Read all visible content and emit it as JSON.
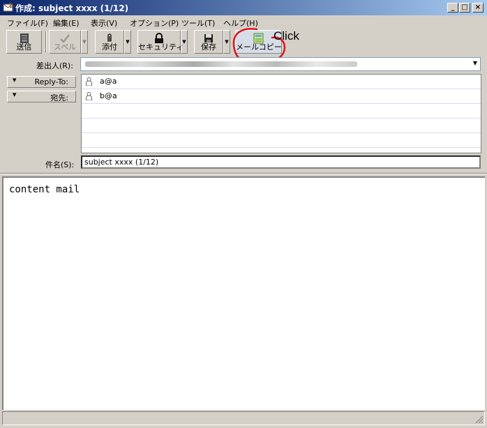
{
  "window": {
    "title": "作成: subject xxxx (1/12)",
    "minimize_glyph": "_",
    "maximize_glyph": "□",
    "close_glyph": "×"
  },
  "menu": [
    "ファイル(F)",
    "編集(E)",
    "表示(V)",
    "オプション(P)",
    "ツール(T)",
    "ヘルプ(H)"
  ],
  "toolbar": {
    "send": "送信",
    "spell": "スペル",
    "attach": "添付",
    "security": "セキュリティ",
    "save": "保存",
    "mailcopy": "メールコピー",
    "dropdown_glyph": "▼"
  },
  "annotation": {
    "text": "Click",
    "color": "#e0141e"
  },
  "header": {
    "from_label": "差出人(R):",
    "dropdown_glyph": "▼",
    "reply_to_label": "Reply-To:",
    "to_label": "宛先:",
    "reply_to_value": "a@a",
    "to_value": "b@a",
    "subject_label": "件名(S):",
    "subject_value": "subject xxxx (1/12)"
  },
  "body": {
    "text": "content mail"
  },
  "colors": {
    "titlebar_start": "#0a246a",
    "titlebar_end": "#a6caf0",
    "face": "#d4d0c8"
  }
}
